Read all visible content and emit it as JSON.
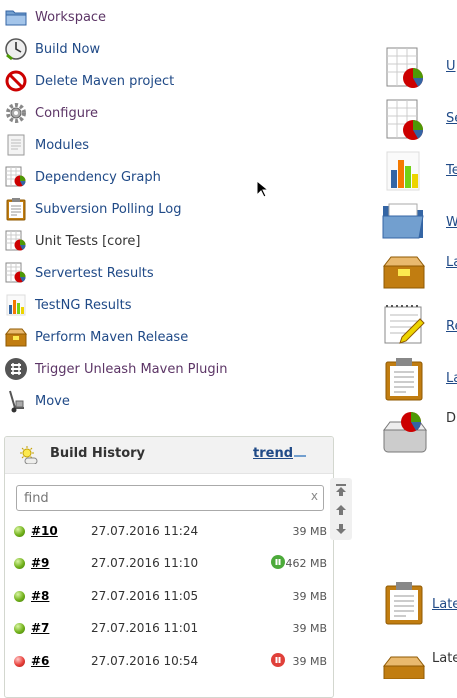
{
  "tasks": [
    {
      "label": "Workspace",
      "icon": "folder-icon",
      "visited": true
    },
    {
      "label": "Build Now",
      "icon": "clock-icon",
      "visited": false
    },
    {
      "label": "Delete Maven project",
      "icon": "no-entry-icon",
      "visited": false
    },
    {
      "label": "Configure",
      "icon": "gear-icon",
      "visited": true
    },
    {
      "label": "Modules",
      "icon": "document-icon",
      "visited": false
    },
    {
      "label": "Dependency Graph",
      "icon": "report-chart-icon",
      "visited": false
    },
    {
      "label": "Subversion Polling Log",
      "icon": "clipboard-icon",
      "visited": false
    },
    {
      "label": "Unit Tests [core]",
      "icon": "report-chart-icon",
      "visited": false,
      "plain": true
    },
    {
      "label": "Servertest Results",
      "icon": "report-chart-icon",
      "visited": false
    },
    {
      "label": "TestNG Results",
      "icon": "bar-chart-icon",
      "visited": false
    },
    {
      "label": "Perform Maven Release",
      "icon": "package-icon",
      "visited": false
    },
    {
      "label": "Trigger Unleash Maven Plugin",
      "icon": "unleash-icon",
      "visited": false
    },
    {
      "label": "Move",
      "icon": "hand-truck-icon",
      "visited": false
    }
  ],
  "build_history": {
    "title": "Build History",
    "trend": "trend",
    "find_placeholder": "find",
    "clear": "x",
    "builds": [
      {
        "number": "#10",
        "date": "27.07.2016 11:24",
        "size": "39 MB",
        "status": "success",
        "badge": null
      },
      {
        "number": "#9",
        "date": "27.07.2016 11:10",
        "size": "462 MB",
        "status": "success",
        "badge": "green"
      },
      {
        "number": "#8",
        "date": "27.07.2016 11:05",
        "size": "39 MB",
        "status": "success",
        "badge": null
      },
      {
        "number": "#7",
        "date": "27.07.2016 11:01",
        "size": "39 MB",
        "status": "success",
        "badge": null
      },
      {
        "number": "#6",
        "date": "27.07.2016 10:54",
        "size": "39 MB",
        "status": "failed",
        "badge": "red"
      }
    ]
  },
  "right": {
    "link1": "U",
    "link2": "Se",
    "link3": "Te",
    "link4": "W",
    "link5": "La",
    "link6": "Re",
    "link7": "La",
    "text8": "D",
    "link9": "Late",
    "text10": "Late"
  }
}
